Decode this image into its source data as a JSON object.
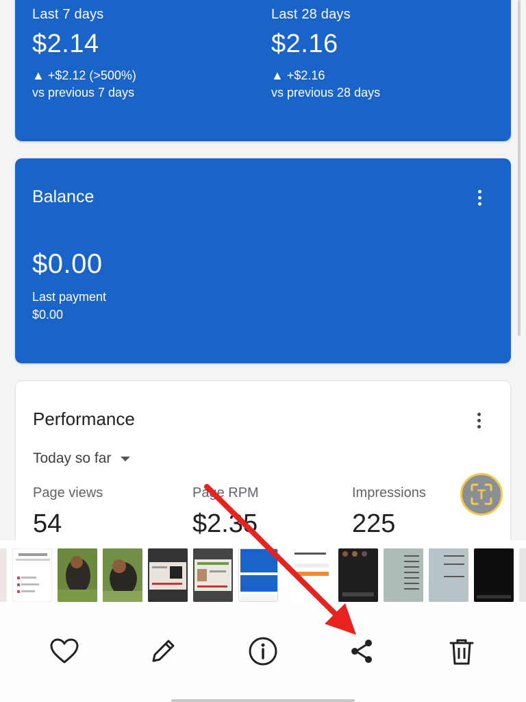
{
  "earnings": {
    "col1": {
      "label": "Last 7 days",
      "amount": "$2.14",
      "change": "▲ +$2.12 (>500%)",
      "vs": "vs previous 7 days"
    },
    "col2": {
      "label": "Last 28 days",
      "amount": "$2.16",
      "change": "▲ +$2.16",
      "vs": "vs previous 28 days"
    }
  },
  "balance": {
    "title": "Balance",
    "amount": "$0.00",
    "last_payment_label": "Last payment",
    "last_payment_value": "$0.00"
  },
  "performance": {
    "title": "Performance",
    "range": "Today so far",
    "metrics": [
      {
        "label": "Page views",
        "value": "54"
      },
      {
        "label": "Page RPM",
        "value": "$2.35"
      },
      {
        "label": "Impressions",
        "value": "225"
      }
    ]
  },
  "badge": {
    "letter": "T"
  },
  "colors": {
    "card_blue": "#1a63c8",
    "badge_ring": "#f2c94c",
    "arrow_red": "#e8231f"
  },
  "gallery": {
    "actions": [
      {
        "name": "favorite",
        "icon": "heart-icon"
      },
      {
        "name": "edit",
        "icon": "pencil-icon"
      },
      {
        "name": "info",
        "icon": "info-icon"
      },
      {
        "name": "share",
        "icon": "share-icon"
      },
      {
        "name": "delete",
        "icon": "trash-icon"
      }
    ]
  }
}
